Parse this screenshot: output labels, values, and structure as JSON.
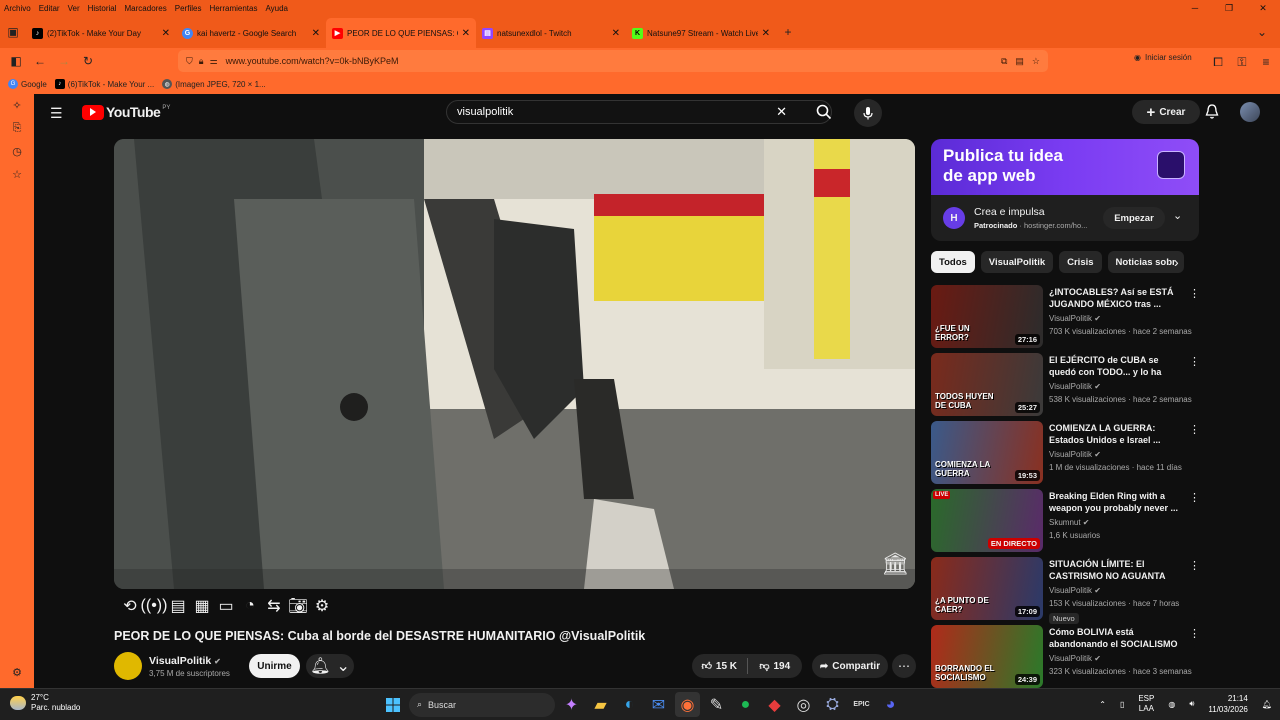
{
  "menubar": {
    "items": [
      "Archivo",
      "Editar",
      "Ver",
      "Historial",
      "Marcadores",
      "Perfiles",
      "Herramientas",
      "Ayuda"
    ]
  },
  "tabs": [
    {
      "label": "(2)TikTok - Make Your Day",
      "icon": "tiktok-icon",
      "color": "#000000"
    },
    {
      "label": "kai havertz - Google Search",
      "icon": "google-icon",
      "color": "#4285f4"
    },
    {
      "label": "PEOR DE LO QUE PIENSAS: Cub",
      "icon": "youtube-icon",
      "color": "#ff0000"
    },
    {
      "label": "natsunexdlol - Twitch",
      "icon": "twitch-icon",
      "color": "#9146ff"
    },
    {
      "label": "Natsune97 Stream - Watch Live",
      "icon": "kick-icon",
      "color": "#53fc18"
    }
  ],
  "nav": {
    "url": "www.youtube.com/watch?v=0k-bNByKPeM",
    "signin": "Iniciar sesión"
  },
  "bookmarks": [
    {
      "label": "Google"
    },
    {
      "label": "(6)TikTok - Make Your ..."
    },
    {
      "label": "(Imagen JPEG, 720 × 1..."
    }
  ],
  "youtube": {
    "brand": "YouTube",
    "country": "PY",
    "search_value": "visualpolitik",
    "create_label": "Crear"
  },
  "video": {
    "title": "PEOR DE LO QUE PIENSAS: Cuba al borde del DESASTRE HUMANITARIO @VisualPolitik",
    "channel": "VisualPolitik",
    "subscribers": "3,75 M de suscriptores",
    "join_label": "Unirme",
    "likes": "15 K",
    "dislikes": "194",
    "share_label": "Compartir"
  },
  "ad": {
    "headline1": "Publica tu idea",
    "headline2": "de app web",
    "title": "Crea e impulsa",
    "sponsored": "Patrocinado",
    "domain": "hostinger.com/ho...",
    "cta": "Empezar"
  },
  "chips": [
    "Todos",
    "VisualPolitik",
    "Crisis",
    "Noticias sobr"
  ],
  "recommendations": [
    {
      "title": "¿INTOCABLES? Así se ESTÁ JUGANDO MÉXICO tras ...",
      "channel": "VisualPolitik",
      "stats": "703 K visualizaciones · hace 2 semanas",
      "duration": "27:16",
      "caption": "¿FUE UN ERROR?",
      "bg1": "#6b1a12",
      "bg2": "#2c2c2c"
    },
    {
      "title": "El EJÉRCITO de CUBA se quedó con TODO... y lo ha DESTRUID...",
      "channel": "VisualPolitik",
      "stats": "538 K visualizaciones · hace 2 semanas",
      "duration": "25:27",
      "caption": "TODOS HUYEN DE CUBA",
      "bg1": "#7a2a1c",
      "bg2": "#3a3a3a"
    },
    {
      "title": "COMIENZA LA GUERRA: Estados Unidos e Israel ...",
      "channel": "VisualPolitik",
      "stats": "1 M de visualizaciones · hace 11 días",
      "duration": "19:53",
      "caption": "COMIENZA LA GUERRA",
      "bg1": "#3a5a8a",
      "bg2": "#8a3020"
    },
    {
      "title": "Breaking Elden Ring with a weapon you probably never ...",
      "channel": "Skumnut",
      "stats": "1,6 K usuarios",
      "duration": "EN DIRECTO",
      "caption": "",
      "live_tag": "LIVE",
      "bg1": "#2a6a2a",
      "bg2": "#5a2a6a"
    },
    {
      "title": "SITUACIÓN LÍMITE: El CASTRISMO NO AGUANTA m...",
      "channel": "VisualPolitik",
      "stats": "153 K visualizaciones · hace 7 horas",
      "duration": "17:09",
      "caption": "¿A PUNTO DE CAER?",
      "badge": "Nuevo",
      "bg1": "#8a2a1a",
      "bg2": "#2a3a6a"
    },
    {
      "title": "Cómo BOLIVIA está abandonando el SOCIALISMO ...",
      "channel": "VisualPolitik",
      "stats": "323 K visualizaciones · hace 3 semanas",
      "duration": "24:39",
      "caption": "BORRANDO EL SOCIALISMO",
      "bg1": "#b02a1a",
      "bg2": "#2a7a2a"
    }
  ],
  "taskbar": {
    "temp": "27°C",
    "weather": "Parc. nublado",
    "search": "Buscar",
    "lang1": "ESP",
    "lang2": "LAA",
    "time": "21:14",
    "date": "11/03/2026"
  }
}
